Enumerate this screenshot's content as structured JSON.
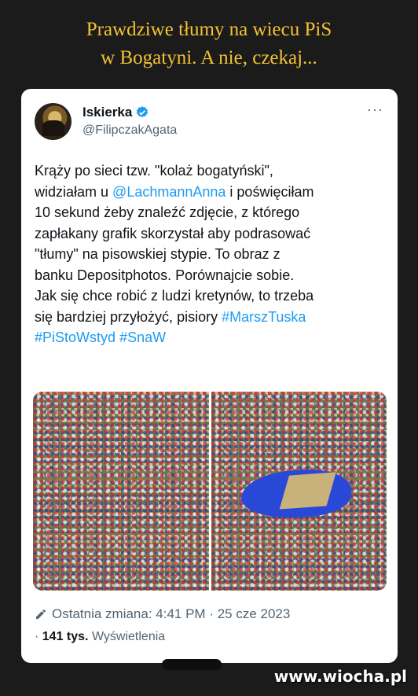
{
  "meme": {
    "title_line1": "Prawdziwe tłumy na wiecu PiS",
    "title_line2": "w Bogatyni. A nie, czekaj...",
    "title_color": "#f2c230",
    "watermark": "www.wiocha.pl"
  },
  "tweet": {
    "display_name": "Iskierka",
    "handle": "@FilipczakAgata",
    "verified": true,
    "more_icon": "more-icon",
    "text_lines": [
      {
        "a": "Krąży po sieci tzw. \"kolaż bogatyński\","
      },
      {
        "a": "widziałam u ",
        "link": "@LachmannAnna",
        "b": " i poświęciłam"
      },
      {
        "a": "10 sekund żeby znaleźć zdjęcie, z którego"
      },
      {
        "a": "zapłakany grafik skorzystał aby podrasować"
      },
      {
        "a": "\"tłumy\" na pisowskiej stypie. To obraz z"
      },
      {
        "a": "banku Depositphotos. Porównajcie sobie."
      },
      {
        "a": "Jak się chce robić z ludzi kretynów, to trzeba"
      },
      {
        "a": "się bardziej przyłożyć, pisiory  ",
        "link": "#MarszTuska"
      },
      {
        "link": "#PiStoWstyd",
        "b": " ",
        "link2": "#SnaW"
      }
    ],
    "edited_label": "Ostatnia zmiana: 4:41 PM · 25 cze 2023",
    "views_count": "141 tys.",
    "views_label": "Wyświetlenia",
    "link_color": "#1d9bf0"
  }
}
